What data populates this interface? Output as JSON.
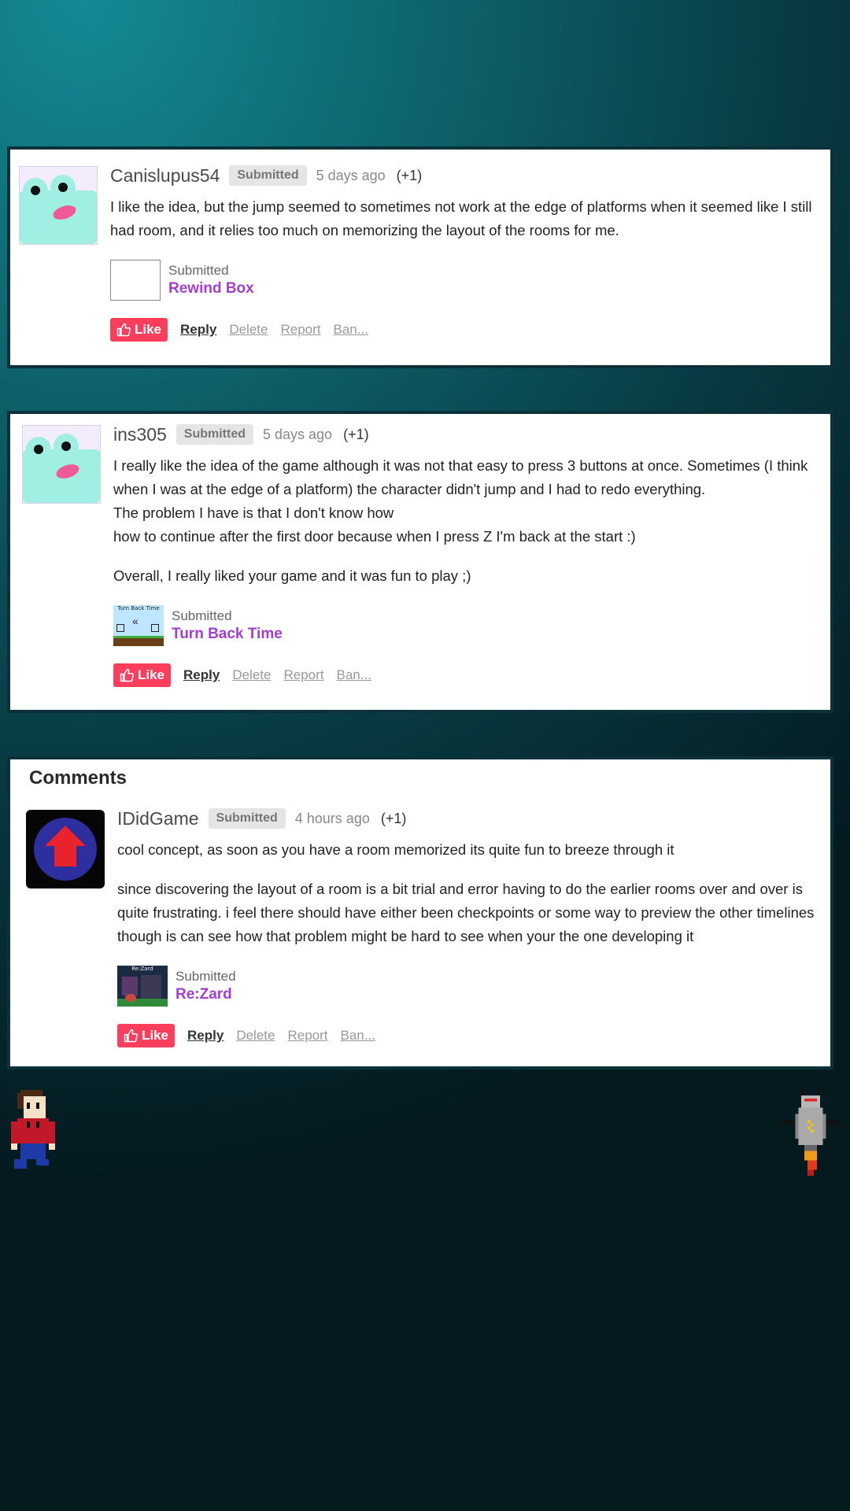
{
  "comments": [
    {
      "username": "Canislupus54",
      "badge": "Submitted",
      "time": "5 days ago",
      "votes": "(+1)",
      "paragraphs": [
        "I like the idea, but the jump seemed to sometimes not work at the edge of platforms when it seemed like I still had room, and it relies too much on memorizing the layout of the rooms for me."
      ],
      "submission": {
        "label": "Submitted",
        "title": "Rewind Box"
      }
    },
    {
      "username": "ins305",
      "badge": "Submitted",
      "time": "5 days ago",
      "votes": "(+1)",
      "paragraphs": [
        "I really like the idea of the game although it was not that easy to press 3 buttons at once. Sometimes (I think when I was at the edge of a platform) the character didn't jump and I had to redo everything.",
        "The problem I have is that I don't know how",
        "how to continue after the first door because when I press Z I'm back at the start :)",
        "Overall, I really liked your game and it was fun to play ;)"
      ],
      "submission": {
        "label": "Submitted",
        "title": "Turn Back Time",
        "thumb_caption": "Turn Back Time"
      }
    },
    {
      "username": "IDidGame",
      "badge": "Submitted",
      "time": "4 hours ago",
      "votes": "(+1)",
      "paragraphs": [
        "cool concept, as soon as you have a room memorized its quite fun to breeze through it",
        "since discovering the layout of a room is a bit trial and error having to do the earlier rooms over and over is quite frustrating. i feel there should have either been checkpoints or some way to preview the other timelines though is can see how that problem might be hard to see when your the one developing it"
      ],
      "submission": {
        "label": "Submitted",
        "title": "Re:Zard",
        "thumb_caption": "Re:Zard"
      }
    }
  ],
  "comments_section": {
    "heading": "Comments"
  },
  "actions": {
    "like": "Like",
    "reply": "Reply",
    "delete": "Delete",
    "report": "Report",
    "ban": "Ban..."
  },
  "colors": {
    "like": "#fa3e5c",
    "link": "#a23fd1",
    "badge_bg": "#e5e5e5",
    "frog": "#9ff0e2",
    "house_icon": "#e8232b",
    "house_circle": "#2e2f9e"
  },
  "icons": {
    "like": "thumbs-up-icon",
    "avatar_1": "frog-avatar",
    "avatar_2": "frog-avatar",
    "avatar_3": "house-arrow-avatar"
  }
}
